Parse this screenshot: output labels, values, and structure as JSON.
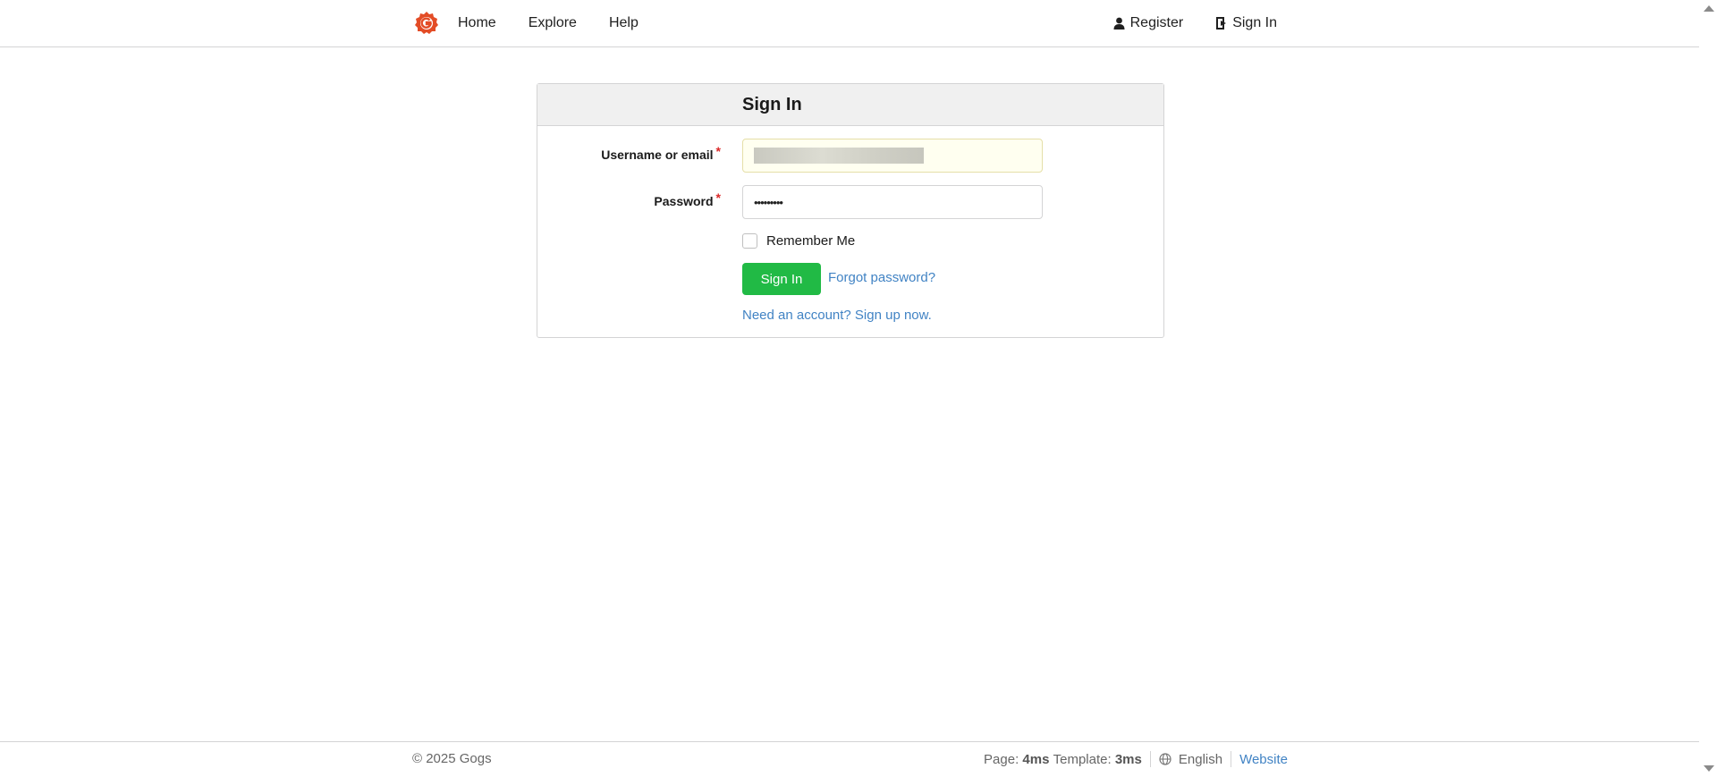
{
  "header": {
    "nav": [
      {
        "label": "Home"
      },
      {
        "label": "Explore"
      },
      {
        "label": "Help"
      }
    ],
    "register_label": "Register",
    "signin_label": "Sign In"
  },
  "signin_form": {
    "title": "Sign In",
    "username_label": "Username or email",
    "username_value": "",
    "password_label": "Password",
    "password_value": "•••••••••",
    "remember_label": "Remember Me",
    "remember_checked": false,
    "submit_label": "Sign In",
    "forgot_link": "Forgot password?",
    "signup_link": "Need an account? Sign up now.",
    "required_mark": "*"
  },
  "footer": {
    "copyright": "© 2025 Gogs",
    "page_label": "Page:",
    "page_time": "4ms",
    "template_label": "Template:",
    "template_time": "3ms",
    "language": "English",
    "website_link": "Website"
  },
  "colors": {
    "accent_green": "#21ba45",
    "link_blue": "#4183c4",
    "required_red": "#db2828",
    "logo_red": "#e34c26"
  },
  "icons": {
    "logo": "gogs-logo-icon",
    "register": "user-icon",
    "signin": "sign-in-icon",
    "language": "globe-icon"
  }
}
